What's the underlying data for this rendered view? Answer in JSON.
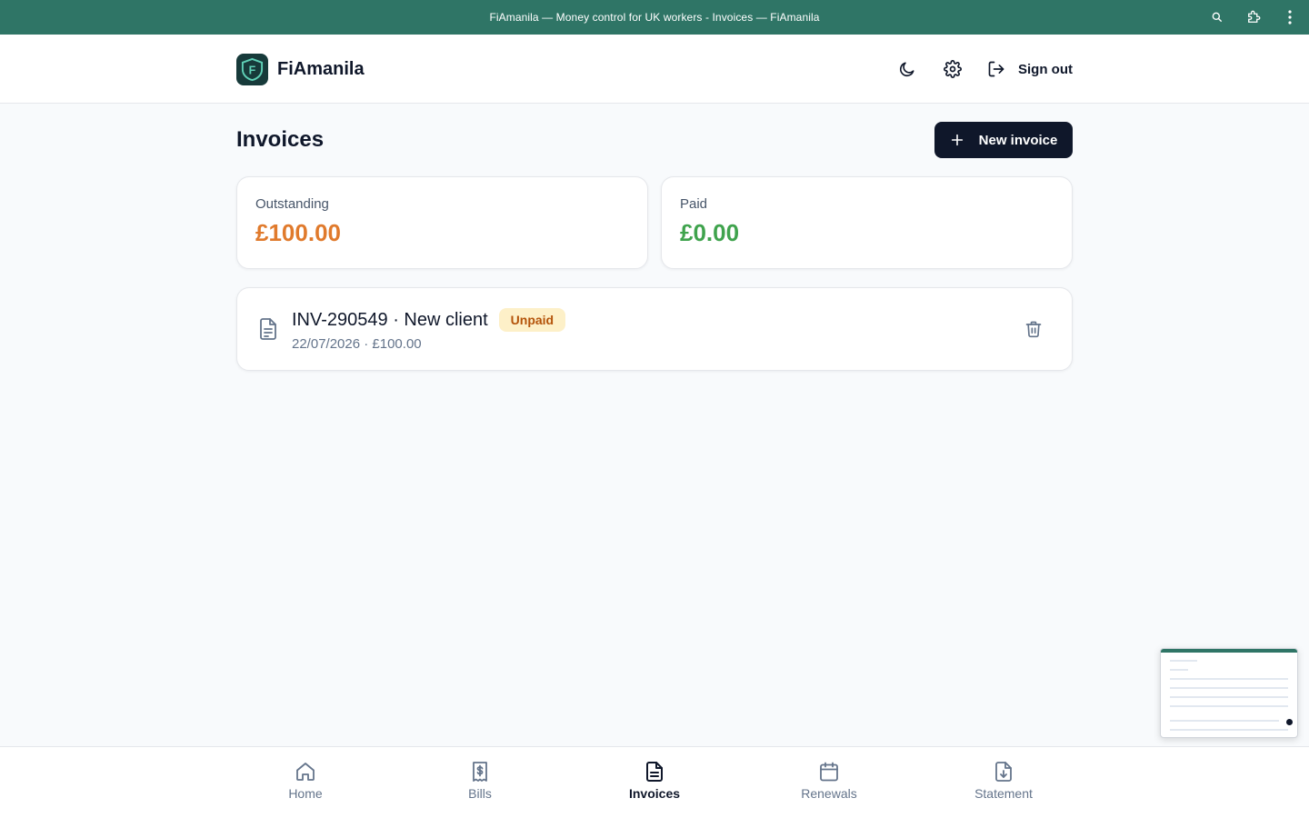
{
  "browser": {
    "title": "FiAmanila — Money control for UK workers - Invoices — FiAmanila",
    "icons": [
      "zoom-icon",
      "extensions-icon",
      "more-icon"
    ]
  },
  "header": {
    "brand_name": "FiAmanila",
    "logo_letter": "F",
    "dark_mode_icon": "moon-icon",
    "settings_icon": "gear-icon",
    "signout_label": "Sign out"
  },
  "page": {
    "title": "Invoices",
    "new_invoice_label": "New invoice"
  },
  "summary": {
    "outstanding_label": "Outstanding",
    "outstanding_value": "£100.00",
    "paid_label": "Paid",
    "paid_value": "£0.00"
  },
  "invoices": [
    {
      "title": "INV-290549 · New client",
      "status": "Unpaid",
      "meta": "22/07/2026 · £100.00"
    }
  ],
  "nav": [
    {
      "label": "Home",
      "icon": "home-icon",
      "active": false
    },
    {
      "label": "Bills",
      "icon": "receipt-icon",
      "active": false
    },
    {
      "label": "Invoices",
      "icon": "document-icon",
      "active": true
    },
    {
      "label": "Renewals",
      "icon": "calendar-icon",
      "active": false
    },
    {
      "label": "Statement",
      "icon": "download-file-icon",
      "active": false
    }
  ],
  "colors": {
    "titlebar": "#2f7566",
    "primary": "#0f172a",
    "outstanding": "#e07a2c",
    "paid": "#3fa34d",
    "badge_bg": "#fdf0c8",
    "badge_text": "#b45309"
  }
}
